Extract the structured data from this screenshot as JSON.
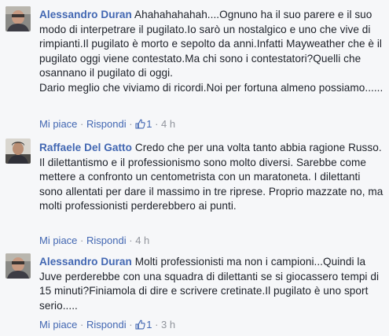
{
  "comments": [
    {
      "author": "Alessandro Duran",
      "text": "Ahahahahahah....Ognuno ha il suo parere e il suo modo di interpetrare il pugilato.Io sarò un nostalgico e uno che vive di rimpianti.Il pugilato è morto e sepolto da anni.Infatti Mayweather che è il pugilato oggi viene contestato.Ma chi sono i contestatori?Quelli che osannano il pugilato di oggi.\nDario meglio che viviamo di ricordi.Noi per fortuna almeno possiamo......",
      "like_label": "Mi piace",
      "dot": "·",
      "reply_label": "Rispondi",
      "reactions_count": "1",
      "time": "4 h",
      "avatar_icon": "profile-photo-icon"
    },
    {
      "author": "Raffaele Del Gatto",
      "text": "Credo che per una volta tanto abbia ragione Russo. Il dilettantismo e il professionismo sono molto diversi. Sarebbe come mettere a confronto un centometrista con un maratoneta. I dilettanti sono allentati per dare il massimo in tre riprese. Proprio mazzate no, ma molti professionisti perderebbero ai punti.",
      "like_label": "Mi piace",
      "dot": "·",
      "reply_label": "Rispondi",
      "reactions_count": "",
      "time": "4 h",
      "avatar_icon": "profile-photo-icon"
    },
    {
      "author": "Alessandro Duran",
      "text": "Molti professionisti ma non i campioni...Quindi la Juve perderebbe con una squadra di dilettanti se si giocassero tempi di 15 minuti?Finiamola di dire e scrivere cretinate.Il pugilato è uno sport serio.....",
      "like_label": "Mi piace",
      "dot": "·",
      "reply_label": "Rispondi",
      "reactions_count": "1",
      "time": "3 h",
      "avatar_icon": "profile-photo-icon"
    }
  ],
  "colors": {
    "background": "#f6f7f9",
    "link": "#4267b2",
    "text": "#1d2129",
    "meta": "#90949c"
  }
}
